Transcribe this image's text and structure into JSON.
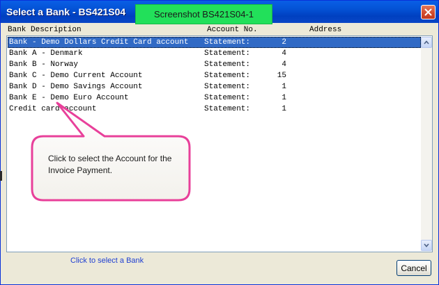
{
  "window": {
    "title": "Select a Bank - BS421S04"
  },
  "badge": {
    "label": "Screenshot BS421S04-1",
    "color": "#22e05a"
  },
  "list": {
    "columns": {
      "description": "Bank Description",
      "account": "Account No.",
      "address": "Address"
    },
    "rows": [
      {
        "description": "Bank - Demo Dollars Credit Card account",
        "account": "Statement:",
        "number": "2"
      },
      {
        "description": "Bank A - Denmark",
        "account": "Statement:",
        "number": "4"
      },
      {
        "description": "Bank B - Norway",
        "account": "Statement:",
        "number": "4"
      },
      {
        "description": "Bank C - Demo Current Account",
        "account": "Statement:",
        "number": "15"
      },
      {
        "description": "Bank D - Demo Savings Account",
        "account": "Statement:",
        "number": "1"
      },
      {
        "description": "Bank E - Demo Euro Account",
        "account": "Statement:",
        "number": "1"
      },
      {
        "description": "Credit card account",
        "account": "Statement:",
        "number": "1"
      }
    ],
    "selected_index": 0
  },
  "callout": {
    "text": "Click to select the Account for the Invoice Payment.",
    "border_color": "#e8409a"
  },
  "status": {
    "link_text": "Click to select a Bank"
  },
  "buttons": {
    "cancel_label": "Cancel"
  },
  "icons": {
    "close": "close-icon",
    "scroll_up": "chevron-up-icon",
    "scroll_down": "chevron-down-icon"
  },
  "colors": {
    "titlebar": "#0453d6",
    "selection": "#316ac5",
    "link": "#1f3fd1"
  }
}
